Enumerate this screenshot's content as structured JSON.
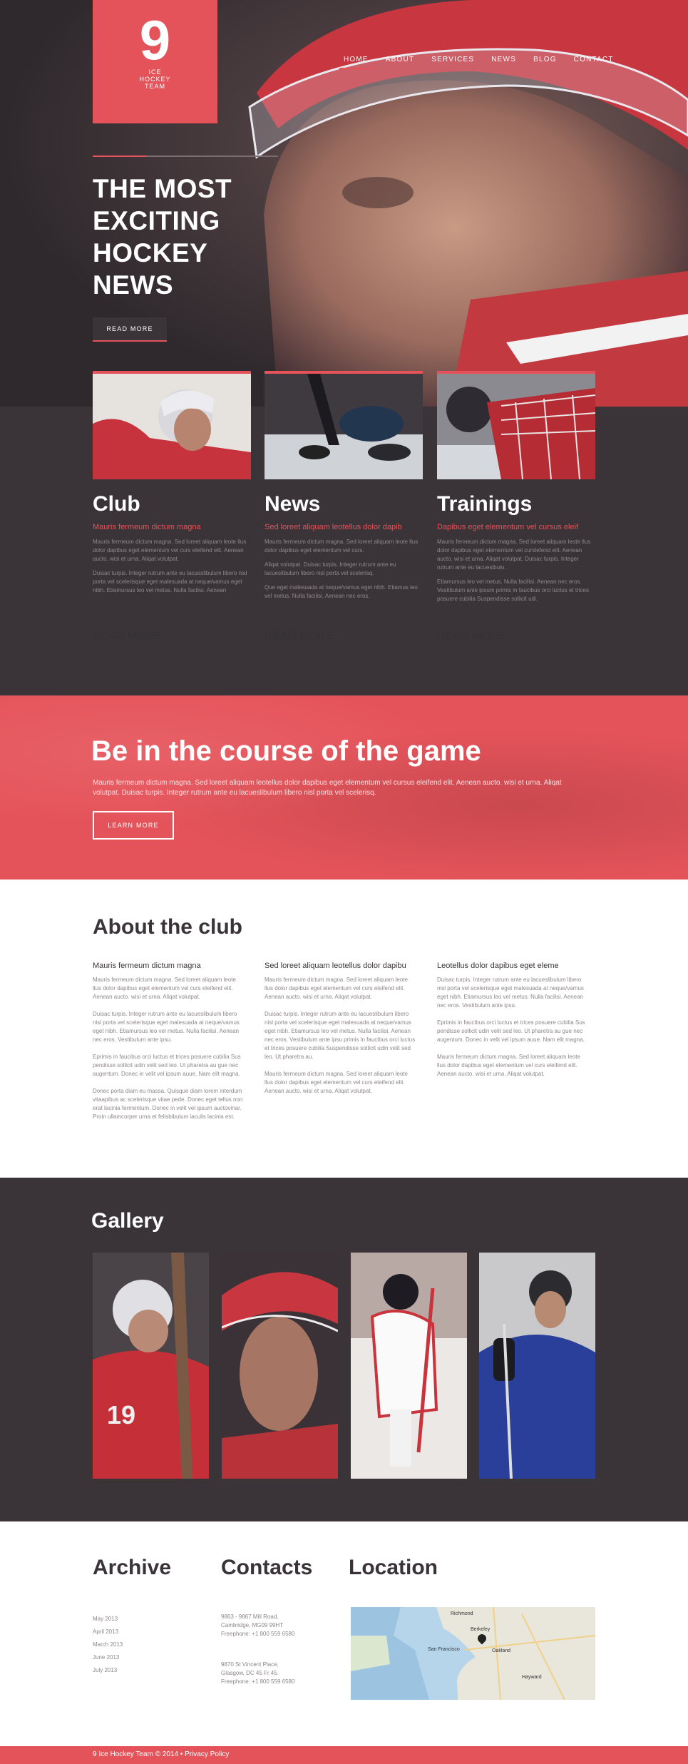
{
  "logo": {
    "number": "9",
    "line1": "ICE",
    "line2": "HOCKEY",
    "line3": "TEAM"
  },
  "nav": [
    "HOME",
    "ABOUT",
    "SERVICES",
    "NEWS",
    "BLOG",
    "CONTACT"
  ],
  "hero": {
    "title_lines": [
      "THE MOST",
      "EXCITING",
      "HOCKEY",
      "NEWS"
    ],
    "button": "READ MORE"
  },
  "features": [
    {
      "title": "Club",
      "subtitle": "Mauris fermeum dictum magna",
      "p1": "Mauris fermeum dictum magna. Sed loreet aliquam leote llus dolor dapibus eget elementum vel curs eleifend elit. Aenean aucto. wisi et urna. Aliqat volutpat.",
      "p2": "Duisac turpis. Integer rutrum ante eu lacueslibulum libero nisl porta vel scelerisque eget malesuada at neque/vamus eget nibh. Etiamursus leo vel metus. Nulla facilisi. Aenean",
      "button": "READ MORE"
    },
    {
      "title": "News",
      "subtitle": "Sed loreet aliquam leotellus dolor dapib",
      "p1": "Mauris fermeum dictum magna. Sed loreet aliquam leote llus dolor dapibus eget elementum vel curs.",
      "p2": "Aliqat volutpat. Duisac turpis. Integer rutrum ante eu lacueslibulum libero nisl porta vel scelerisq.",
      "p3": "Que eget malesuada at neque/vamus eget nibh. Etiamus leo vel metus. Nulla facilisi. Aenean nec eros.",
      "button": "READ MORE"
    },
    {
      "title": "Trainings",
      "subtitle": "Dapibus eget elementum vel cursus eleif",
      "p1": "Mauris fermeum dictum magna. Sed loreet aliquam leote llus dolor dapibus eget elementum vel curslefend elit. Aenean aucto. wisi et urna. Aliqat volutpat. Duisac turpis. Integer rutrum ante eu lacueslbulu.",
      "p2": "Etiamursus leo vel metus. Nulla facilisi. Aenean nec eros. Vestibulum ante ipsum primis in faucibus orci luctus et trices posuere cubilia Suspendisse sollicit udi.",
      "button": "READ MORE"
    }
  ],
  "banner": {
    "title": "Be in the course of the game",
    "text": "Mauris fermeum dictum magna. Sed loreet aliquam leotellus dolor dapibus eget elementum vel cursus eleifend elit. Aenean aucto. wisi et urna. Aliqat volutpat. Duisac turpis. Integer rutrum ante eu lacueslibulum libero nisl porta vel scelerisq.",
    "button": "LEARN MORE"
  },
  "about": {
    "title": "About the club",
    "cols": [
      {
        "head": "Mauris fermeum dictum magna",
        "paras": [
          "Mauris fermeum dictum magna. Sed loreet aliquam leote llus dolor dapibus eget elementum vel curs eleifend elit. Aenean aucto. wisi et urna. Aliqat volutpat.",
          "Duisac turpis. Integer rutrum ante eu lacueslibulum libero nisl porta vel scelerisque eget malesuada at neque/vamus eget nibh. Etiamursus leo vel metus. Nulla facilisi. Aenean nec eros. Vestibulum ante ipsu.",
          "Eprimis in faucibus orci luctus et trices posuere cubilia Sus pendisse sollicit udin velit sed leo. Ut pharetra au gue nec augentum. Donec in velit vel ipsum auue. Nam elit magna.",
          "Donec porta diam eu massa. Quisque diam lorem interdum vitaapibus ac scelerisque vitae pede. Donec eget tellus non erat lacinia fermentum. Donec in velit vel ipsum auctovinar. Proin ullamcorper urna et felisbibulum iaculis lacinia est."
        ]
      },
      {
        "head": "Sed loreet aliquam leotellus dolor dapibu",
        "paras": [
          "Mauris fermeum dictum magna. Sed loreet aliquam leote llus dolor dapibus eget elementum vel curs eleifend elit. Aenean aucto. wisi et urna. Aliqat volutpat.",
          "Duisac turpis. Integer rutrum ante eu lacueslibulum libero nisl porta vel scelerisque eget malesuada at neque/vamus eget nibh. Etiamursus leo vel metus. Nulla facilisi. Aenean nec eros. Vestibulum ante ipsu primis in faucibus orci luctus et trices posuere cubilia Suspendisse sollicit udin velit sed leo. Ut pharetra au.",
          "Mauris fermeum dictum magna. Sed loreet aliquam leote llus dolor dapibus eget elementum vel curs eleifend elit. Aenean aucto. wisi et urna. Aliqat volutpat."
        ]
      },
      {
        "head": "Leotellus dolor dapibus eget eleme",
        "paras": [
          "Duisac turpis. Integer rutrum ante eu lacueslibulum libero nisl porta vel scelerisque eget malesuada at neque/vamus eget nibh. Etiamursus leo vel metus. Nulla facilisi. Aenean nec eros. Vestibulum ante ipsu.",
          "Eprimis in faucibus orci luctus et trices posuere cubilia Sus pendisse sollicit udin velit sed leo. Ut pharetra au gue nec augentum. Donec in velit vel ipsum auue. Nam elit magna.",
          "Mauris fermeum dictum magna. Sed loreet aliquam leote llus dolor dapibus eget elementum vel curs eleifend elit. Aenean aucto. wisi et urna. Aliqat volutpat."
        ]
      }
    ]
  },
  "gallery": {
    "title": "Gallery"
  },
  "archive": {
    "title": "Archive",
    "items": [
      "May 2013",
      "April 2013",
      "March 2013",
      "June 2013",
      "July 2013"
    ]
  },
  "contacts": {
    "title": "Contacts",
    "addr1": [
      "9863 - 9867 Mill Road,",
      "Cambridge, MG09 99HT",
      "Freephone:  +1 800 559 6580"
    ],
    "addr2": [
      "9870 St Vincent Place,",
      "Glasgow, DC 45 Fr 45.",
      "Freephone:  +1 800 559 6580"
    ]
  },
  "location": {
    "title": "Location",
    "map_labels": [
      "San Francisco",
      "Richmond",
      "Berkeley",
      "Oakland",
      "Hayward"
    ]
  },
  "footer": {
    "text": "9 Ice Hockey Team © 2014 • Privacy Policy"
  },
  "colors": {
    "accent": "#e5535a",
    "dark": "#3a3338"
  }
}
